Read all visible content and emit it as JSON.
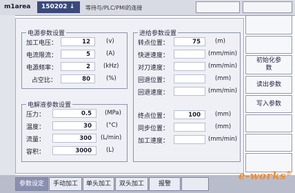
{
  "topbar": {
    "area": "m1area",
    "code": "150202",
    "code_arrow": "↓",
    "status": "等待与/PLC/PMI的连接"
  },
  "power": {
    "title": "电源参数设置",
    "rows": [
      {
        "label": "加工电压：",
        "value": "12",
        "unit": "(v)"
      },
      {
        "label": "电流限流：",
        "value": "5",
        "unit": "(A)"
      },
      {
        "label": "电源频率：",
        "value": "2",
        "unit": "(kHz)"
      },
      {
        "label": "占空比：",
        "value": "80",
        "unit": "(%)"
      }
    ]
  },
  "electrolyte": {
    "title": "电解液参数设置",
    "rows": [
      {
        "label": "压力：",
        "value": "0.5",
        "unit": "(MPa)"
      },
      {
        "label": "温度：",
        "value": "30",
        "unit": "(°C)"
      },
      {
        "label": "流量：",
        "value": "300",
        "unit": "(L/min)"
      },
      {
        "label": "容积：",
        "value": "3000",
        "unit": "(L)"
      }
    ]
  },
  "feed": {
    "title": "进给参数设置",
    "rows": [
      {
        "label": "转点位置：",
        "value": "75",
        "unit": "(m)"
      },
      {
        "label": "快进速度：",
        "value": "",
        "unit": "(mm/min)"
      },
      {
        "label": "对刀速度：",
        "value": "",
        "unit": "(mm/min)"
      },
      {
        "label": "回退位置：",
        "value": "",
        "unit": "(mm)"
      },
      {
        "label": "回退速度：",
        "value": "",
        "unit": "(mm/min)"
      },
      {
        "label": "终点位置：",
        "value": "100",
        "unit": "(mm)"
      },
      {
        "label": "同步位置：",
        "value": "",
        "unit": "(mm)"
      },
      {
        "label": "加工速度：",
        "value": "",
        "unit": "(mm/min)"
      }
    ]
  },
  "right_buttons": [
    {
      "label": ""
    },
    {
      "label": ""
    },
    {
      "label": "初始化参数"
    },
    {
      "label": "读出参数"
    },
    {
      "label": "写入参数"
    },
    {
      "label": ""
    },
    {
      "label": ""
    },
    {
      "label": ""
    }
  ],
  "tabs": [
    {
      "label": "参数设定",
      "active": true
    },
    {
      "label": "手动加工",
      "active": false
    },
    {
      "label": "单头加工",
      "active": false
    },
    {
      "label": "双头加工",
      "active": false
    },
    {
      "label": "报警",
      "active": false
    }
  ],
  "watermark": {
    "text": "e-works",
    "mark": "®"
  }
}
